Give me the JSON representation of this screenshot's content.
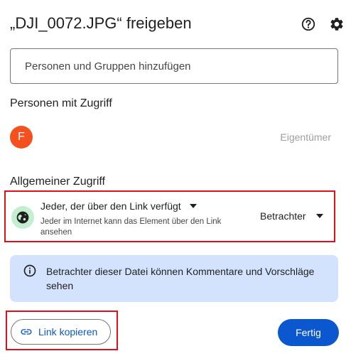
{
  "dialog": {
    "title": "„DJI_0072.JPG“ freigeben",
    "help_icon": "help-circle-icon",
    "settings_icon": "gear-icon"
  },
  "add_people": {
    "placeholder": "Personen und Gruppen hinzufügen"
  },
  "people_section": {
    "heading": "Personen mit Zugriff",
    "people": [
      {
        "avatar_initial": "F",
        "avatar_color": "#f4511e",
        "role": "Eigentümer"
      }
    ]
  },
  "general_access": {
    "heading": "Allgemeiner Zugriff",
    "icon": "globe-icon",
    "icon_bg": "#c4eed0",
    "scope": "Jeder, der über den Link verfügt",
    "description": "Jeder im Internet kann das Element über den Link ansehen",
    "role": "Betrachter"
  },
  "info": {
    "icon": "info-icon",
    "text": "Betrachter dieser Datei können Kommentare und Vorschläge sehen",
    "bg_color": "#d3e3fd"
  },
  "footer": {
    "copy_link_label": "Link kopieren",
    "copy_link_icon": "link-icon",
    "done_label": "Fertig"
  },
  "colors": {
    "accent": "#0b57d0",
    "highlight_border": "#e0101a"
  }
}
